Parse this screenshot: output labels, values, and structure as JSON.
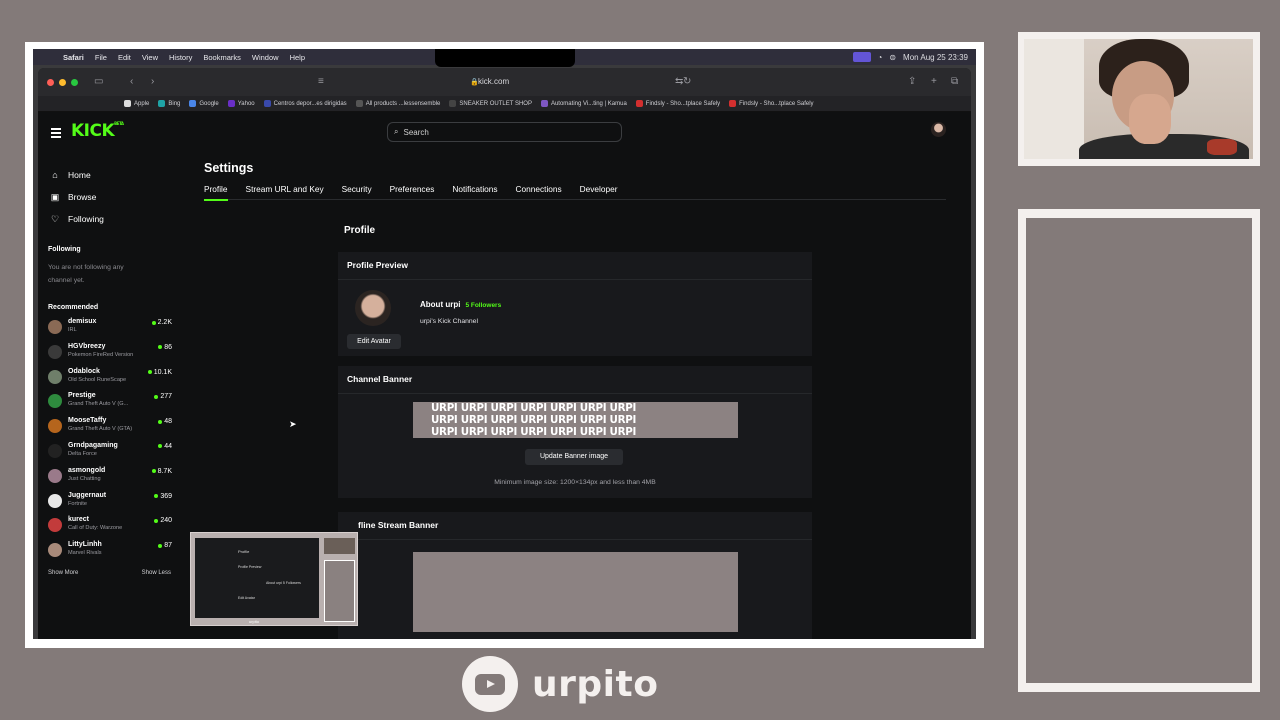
{
  "menubar": {
    "apple": "",
    "items": [
      "Safari",
      "File",
      "Edit",
      "View",
      "History",
      "Bookmarks",
      "Window",
      "Help"
    ],
    "datetime": "Mon Aug 25  23:39"
  },
  "browser": {
    "url": "kick.com",
    "bookmarks": [
      {
        "label": "Apple",
        "color": "#dddddd"
      },
      {
        "label": "Bing",
        "color": "#1fa3a6"
      },
      {
        "label": "Google",
        "color": "#4a86e8"
      },
      {
        "label": "Yahoo",
        "color": "#6a2fc7"
      },
      {
        "label": "Centros depor...es dirigidas",
        "color": "#3949ab"
      },
      {
        "label": "All products ...lessensemble",
        "color": "#555555"
      },
      {
        "label": "SNEAKER OUTLET SHOP",
        "color": "#444444"
      },
      {
        "label": "Automating Vi...ting | Kamua",
        "color": "#7e57c2"
      },
      {
        "label": "Findsly - Sho...tplace Safely",
        "color": "#d32f2f"
      },
      {
        "label": "Findsly - Sho...tplace Safely",
        "color": "#d32f2f"
      }
    ]
  },
  "kick": {
    "logo": "KICK",
    "logo_badge": "BETA",
    "search_placeholder": "Search",
    "nav": [
      {
        "label": "Home",
        "icon": "home-icon",
        "glyph": "⌂"
      },
      {
        "label": "Browse",
        "icon": "browse-icon",
        "glyph": "▣"
      },
      {
        "label": "Following",
        "icon": "heart-icon",
        "glyph": "♡"
      }
    ],
    "following_title": "Following",
    "following_empty": "You are not following any channel yet.",
    "recommended_title": "Recommended",
    "recommended": [
      {
        "name": "demisux",
        "category": "IRL",
        "viewers": "2.2K",
        "color": "#8a6a55"
      },
      {
        "name": "HGVbreezy",
        "category": "Pokemon FireRed Version",
        "viewers": "86",
        "color": "#3a3a3a"
      },
      {
        "name": "Odablock",
        "category": "Old School RuneScape",
        "viewers": "10.1K",
        "color": "#6f7f6a"
      },
      {
        "name": "Prestige",
        "category": "Grand Theft Auto V (G...",
        "viewers": "277",
        "color": "#2e8b3e"
      },
      {
        "name": "MooseTaffy",
        "category": "Grand Theft Auto V (GTA)",
        "viewers": "48",
        "color": "#b5651d"
      },
      {
        "name": "Grndpagaming",
        "category": "Delta Force",
        "viewers": "44",
        "color": "#222222"
      },
      {
        "name": "asmongold",
        "category": "Just Chatting",
        "viewers": "8.7K",
        "color": "#9a7a8a"
      },
      {
        "name": "Juggernaut",
        "category": "Fortnite",
        "viewers": "369",
        "color": "#e8e8e8"
      },
      {
        "name": "kurect",
        "category": "Call of Duty: Warzone",
        "viewers": "240",
        "color": "#c23b3b"
      },
      {
        "name": "LittyLinhh",
        "category": "Marvel Rivals",
        "viewers": "87",
        "color": "#a88a7a"
      }
    ],
    "show_more": "Show More",
    "show_less": "Show Less",
    "settings_title": "Settings",
    "tabs": [
      "Profile",
      "Stream URL and Key",
      "Security",
      "Preferences",
      "Notifications",
      "Connections",
      "Developer"
    ],
    "active_tab": "Profile",
    "section_title": "Profile",
    "profile_preview": {
      "title": "Profile Preview",
      "about": "About urpi",
      "followers": "5 Followers",
      "description": "urpi's Kick Channel",
      "edit_avatar": "Edit Avatar"
    },
    "channel_banner": {
      "title": "Channel Banner",
      "banner_text": "URPI URPI URPI URPI URPI URPI URPI",
      "update_button": "Update Banner image",
      "min_size": "Minimum image size: 1200×134px and less than 4MB"
    },
    "offline_banner": {
      "title": "fline Stream Banner"
    }
  },
  "pip": {
    "mini_profile": "Profile",
    "mini_preview": "Profile Preview",
    "mini_about": "About urpi  5 Followers",
    "mini_edit": "Edit Avatar",
    "mini_label": "urpito"
  },
  "brand": {
    "channel_name": "urpito"
  }
}
